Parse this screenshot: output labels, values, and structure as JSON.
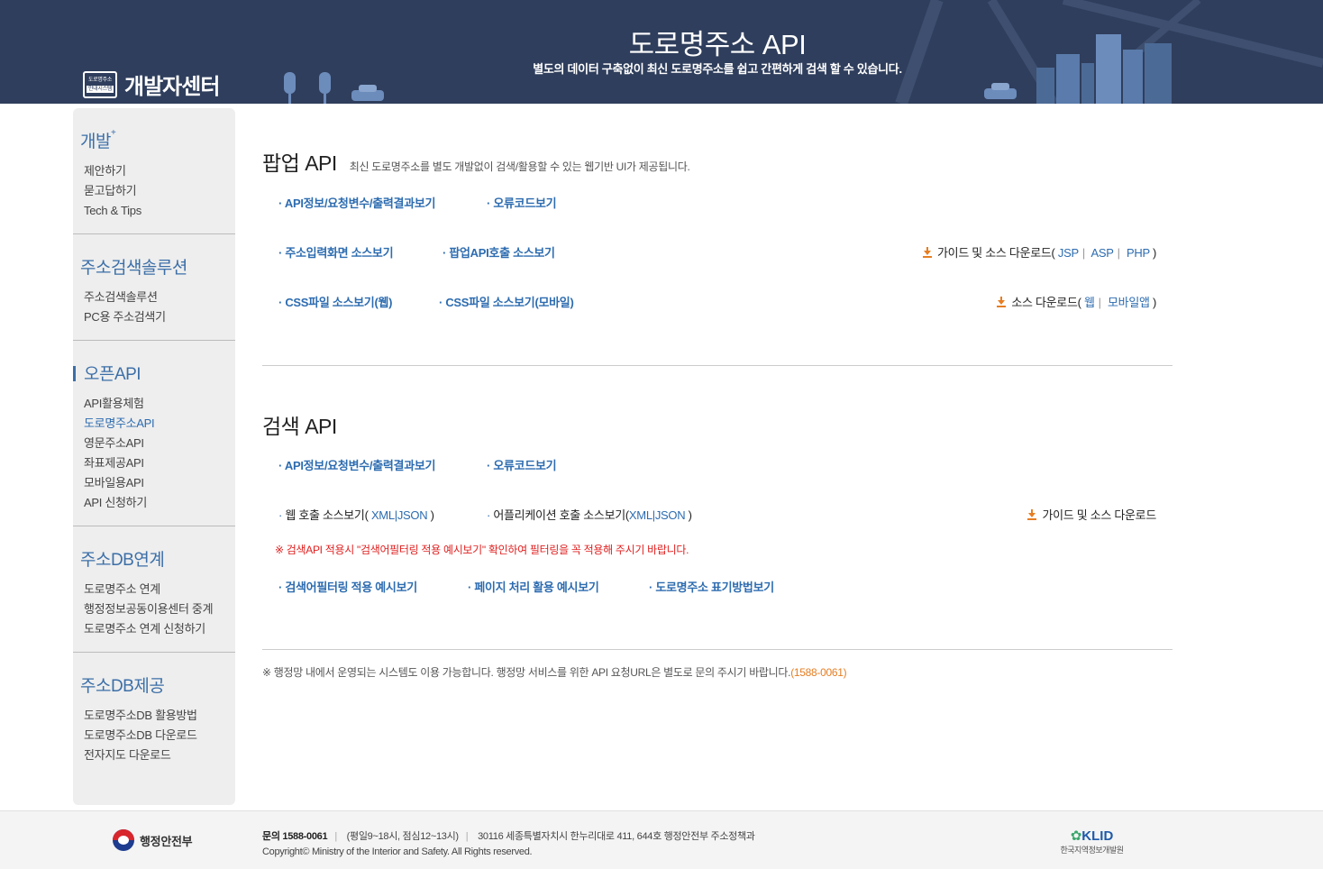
{
  "header": {
    "logo_badge_line1": "도로명주소",
    "logo_badge_line2": "안내시스템",
    "logo_text": "개발자센터",
    "title": "도로명주소 API",
    "subtitle": "별도의 데이터 구축없이 최신 도로명주소를 쉽고 간편하게 검색 할 수 있습니다.",
    "bg_color": "#2f3e5c"
  },
  "sidebar": {
    "groups": [
      {
        "title": "개발",
        "sup": "+",
        "items": [
          "제안하기",
          "묻고답하기",
          "Tech & Tips"
        ]
      },
      {
        "title": "주소검색솔루션",
        "items": [
          "주소검색솔루션",
          "PC용 주소검색기"
        ]
      },
      {
        "title": "오픈API",
        "items": [
          "API활용체험",
          "도로명주소API",
          "영문주소API",
          "좌표제공API",
          "모바일용API",
          "API 신청하기"
        ]
      },
      {
        "title": "주소DB연계",
        "items": [
          "도로명주소 연계",
          "행정정보공동이용센터 중계",
          "도로명주소 연계 신청하기"
        ]
      },
      {
        "title": "주소DB제공",
        "items": [
          "도로명주소DB 활용방법",
          "도로명주소DB 다운로드",
          "전자지도 다운로드"
        ]
      }
    ],
    "active_group": "오픈API",
    "current_item": "도로명주소API"
  },
  "popup": {
    "title": "팝업 API",
    "desc": "최신 도로명주소를 별도 개발없이 검색/활용할 수 있는 웹기반 UI가 제공됩니다.",
    "link_api_info": "API정보/요청변수/출력결과보기",
    "link_error_code": "오류코드보기",
    "link_input_source": "주소입력화면 소스보기",
    "link_popup_call_source": "팝업API호출 소스보기",
    "guide_download_label": "가이드 및 소스 다운로드(",
    "guide_jsp": "JSP",
    "guide_asp": "ASP",
    "guide_php": "PHP",
    "guide_close": ")",
    "link_css_web": "CSS파일 소스보기(웹)",
    "link_css_mobile": "CSS파일 소스보기(모바일)",
    "source_download_label": "소스 다운로드(",
    "source_web": "웹",
    "source_mobile_app": "모바일앱",
    "source_close": ")"
  },
  "search": {
    "title": "검색 API",
    "link_api_info": "API정보/요청변수/출력결과보기",
    "link_error_code": "오류코드보기",
    "web_call_label": "웹 호출 소스보기(",
    "web_xml": "XML",
    "web_json": "JSON",
    "web_close": ")",
    "app_call_label": "어플리케이션 호출 소스보기(",
    "app_xml": "XML",
    "app_json": "JSON",
    "app_close": ")",
    "guide_download": "가이드 및 소스 다운로드",
    "warning": "※ 검색API 적용시 \"검색어필터링 적용 예시보기\" 확인하여 필터링을 꼭 적용해 주시기 바랍니다.",
    "link_filter_example": "검색어필터링 적용 예시보기",
    "link_paging_example": "페이지 처리 활용 예시보기",
    "link_address_notation": "도로명주소 표기방법보기"
  },
  "notice": {
    "text": "※ 행정망 내에서 운영되는 시스템도 이용 가능합니다. 행정망 서비스를 위한 API 요청URL은 별도로 문의 주시기 바랍니다.",
    "tel": "(1588-0061)"
  },
  "footer": {
    "ministry": "행정안전부",
    "contact_label": "문의 1588-0061",
    "hours": "(평일9~18시, 점심12~13시)",
    "address": "30116 세종특별자치시 한누리대로 411, 644호 행정안전부 주소정책과",
    "copyright": "Copyright© Ministry of the Interior and Safety. All Rights reserved.",
    "klid_logo": "KLID",
    "klid_name": "한국지역정보개발원"
  }
}
